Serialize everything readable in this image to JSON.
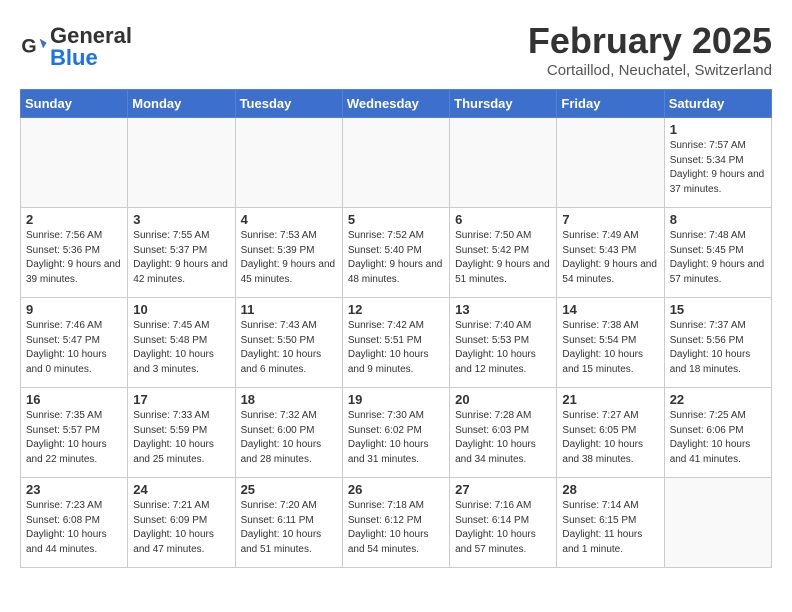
{
  "logo": {
    "text_general": "General",
    "text_blue": "Blue"
  },
  "header": {
    "month_year": "February 2025",
    "location": "Cortaillod, Neuchatel, Switzerland"
  },
  "weekdays": [
    "Sunday",
    "Monday",
    "Tuesday",
    "Wednesday",
    "Thursday",
    "Friday",
    "Saturday"
  ],
  "weeks": [
    [
      {
        "day": "",
        "info": ""
      },
      {
        "day": "",
        "info": ""
      },
      {
        "day": "",
        "info": ""
      },
      {
        "day": "",
        "info": ""
      },
      {
        "day": "",
        "info": ""
      },
      {
        "day": "",
        "info": ""
      },
      {
        "day": "1",
        "info": "Sunrise: 7:57 AM\nSunset: 5:34 PM\nDaylight: 9 hours and 37 minutes."
      }
    ],
    [
      {
        "day": "2",
        "info": "Sunrise: 7:56 AM\nSunset: 5:36 PM\nDaylight: 9 hours and 39 minutes."
      },
      {
        "day": "3",
        "info": "Sunrise: 7:55 AM\nSunset: 5:37 PM\nDaylight: 9 hours and 42 minutes."
      },
      {
        "day": "4",
        "info": "Sunrise: 7:53 AM\nSunset: 5:39 PM\nDaylight: 9 hours and 45 minutes."
      },
      {
        "day": "5",
        "info": "Sunrise: 7:52 AM\nSunset: 5:40 PM\nDaylight: 9 hours and 48 minutes."
      },
      {
        "day": "6",
        "info": "Sunrise: 7:50 AM\nSunset: 5:42 PM\nDaylight: 9 hours and 51 minutes."
      },
      {
        "day": "7",
        "info": "Sunrise: 7:49 AM\nSunset: 5:43 PM\nDaylight: 9 hours and 54 minutes."
      },
      {
        "day": "8",
        "info": "Sunrise: 7:48 AM\nSunset: 5:45 PM\nDaylight: 9 hours and 57 minutes."
      }
    ],
    [
      {
        "day": "9",
        "info": "Sunrise: 7:46 AM\nSunset: 5:47 PM\nDaylight: 10 hours and 0 minutes."
      },
      {
        "day": "10",
        "info": "Sunrise: 7:45 AM\nSunset: 5:48 PM\nDaylight: 10 hours and 3 minutes."
      },
      {
        "day": "11",
        "info": "Sunrise: 7:43 AM\nSunset: 5:50 PM\nDaylight: 10 hours and 6 minutes."
      },
      {
        "day": "12",
        "info": "Sunrise: 7:42 AM\nSunset: 5:51 PM\nDaylight: 10 hours and 9 minutes."
      },
      {
        "day": "13",
        "info": "Sunrise: 7:40 AM\nSunset: 5:53 PM\nDaylight: 10 hours and 12 minutes."
      },
      {
        "day": "14",
        "info": "Sunrise: 7:38 AM\nSunset: 5:54 PM\nDaylight: 10 hours and 15 minutes."
      },
      {
        "day": "15",
        "info": "Sunrise: 7:37 AM\nSunset: 5:56 PM\nDaylight: 10 hours and 18 minutes."
      }
    ],
    [
      {
        "day": "16",
        "info": "Sunrise: 7:35 AM\nSunset: 5:57 PM\nDaylight: 10 hours and 22 minutes."
      },
      {
        "day": "17",
        "info": "Sunrise: 7:33 AM\nSunset: 5:59 PM\nDaylight: 10 hours and 25 minutes."
      },
      {
        "day": "18",
        "info": "Sunrise: 7:32 AM\nSunset: 6:00 PM\nDaylight: 10 hours and 28 minutes."
      },
      {
        "day": "19",
        "info": "Sunrise: 7:30 AM\nSunset: 6:02 PM\nDaylight: 10 hours and 31 minutes."
      },
      {
        "day": "20",
        "info": "Sunrise: 7:28 AM\nSunset: 6:03 PM\nDaylight: 10 hours and 34 minutes."
      },
      {
        "day": "21",
        "info": "Sunrise: 7:27 AM\nSunset: 6:05 PM\nDaylight: 10 hours and 38 minutes."
      },
      {
        "day": "22",
        "info": "Sunrise: 7:25 AM\nSunset: 6:06 PM\nDaylight: 10 hours and 41 minutes."
      }
    ],
    [
      {
        "day": "23",
        "info": "Sunrise: 7:23 AM\nSunset: 6:08 PM\nDaylight: 10 hours and 44 minutes."
      },
      {
        "day": "24",
        "info": "Sunrise: 7:21 AM\nSunset: 6:09 PM\nDaylight: 10 hours and 47 minutes."
      },
      {
        "day": "25",
        "info": "Sunrise: 7:20 AM\nSunset: 6:11 PM\nDaylight: 10 hours and 51 minutes."
      },
      {
        "day": "26",
        "info": "Sunrise: 7:18 AM\nSunset: 6:12 PM\nDaylight: 10 hours and 54 minutes."
      },
      {
        "day": "27",
        "info": "Sunrise: 7:16 AM\nSunset: 6:14 PM\nDaylight: 10 hours and 57 minutes."
      },
      {
        "day": "28",
        "info": "Sunrise: 7:14 AM\nSunset: 6:15 PM\nDaylight: 11 hours and 1 minute."
      },
      {
        "day": "",
        "info": ""
      }
    ]
  ]
}
